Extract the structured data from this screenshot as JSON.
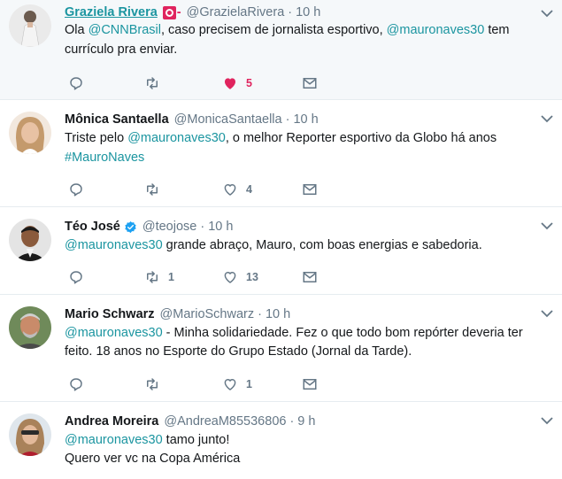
{
  "tweets": [
    {
      "name": "Graziela Rivera",
      "badge_dash": "-",
      "handle": "@GrazielaRivera",
      "dot": "·",
      "time": "10 h",
      "text_parts": [
        {
          "t": "Ola ",
          "link": false
        },
        {
          "t": "@CNNBrasil",
          "link": true
        },
        {
          "t": ", caso precisem de jornalista esportivo, ",
          "link": false
        },
        {
          "t": "@mauronaves30",
          "link": true
        },
        {
          "t": " tem",
          "link": false
        }
      ],
      "text_line2": [
        {
          "t": "currículo pra enviar.",
          "link": false
        }
      ],
      "replies": "",
      "retweets": "",
      "likes": "5",
      "liked": true
    },
    {
      "name": "Mônica Santaella",
      "handle": "@MonicaSantaella",
      "dot": "·",
      "time": "10 h",
      "text_parts": [
        {
          "t": "Triste pelo ",
          "link": false
        },
        {
          "t": "@mauronaves30",
          "link": true
        },
        {
          "t": ", o melhor Reporter esportivo da Globo há anos",
          "link": false
        }
      ],
      "text_line2": [
        {
          "t": "#MauroNaves",
          "link": true
        }
      ],
      "replies": "",
      "retweets": "",
      "likes": "4",
      "liked": false
    },
    {
      "name": "Téo José",
      "handle": "@teojose",
      "dot": "·",
      "time": "10 h",
      "text_parts": [
        {
          "t": "@mauronaves30",
          "link": true
        },
        {
          "t": " grande abraço, Mauro, com boas energias e sabedoria.",
          "link": false
        }
      ],
      "text_line2": [],
      "replies": "",
      "retweets": "1",
      "likes": "13",
      "liked": false
    },
    {
      "name": "Mario Schwarz",
      "handle": "@MarioSchwarz",
      "dot": "·",
      "time": "10 h",
      "text_parts": [
        {
          "t": "@mauronaves30",
          "link": true
        },
        {
          "t": " - Minha solidariedade. Fez o que todo bom repórter deveria ter",
          "link": false
        }
      ],
      "text_line2": [
        {
          "t": "feito. 18 anos no Esporte do Grupo Estado (Jornal da Tarde).",
          "link": false
        }
      ],
      "replies": "",
      "retweets": "",
      "likes": "1",
      "liked": false
    },
    {
      "name": "Andrea Moreira",
      "handle": "@AndreaM85536806",
      "dot": "·",
      "time": "9 h",
      "text_parts": [
        {
          "t": "@mauronaves30",
          "link": true
        },
        {
          "t": " tamo junto!",
          "link": false
        }
      ],
      "text_line2": [
        {
          "t": "Quero ver vc na Copa América",
          "link": false
        }
      ],
      "replies": "",
      "retweets": "",
      "likes": "",
      "liked": false
    }
  ],
  "colors": {
    "link": "#1b95a0",
    "like_active": "#e0245e",
    "muted": "#657786",
    "highlight_bg": "#f5f8fa"
  },
  "icons": {
    "reply": "reply-icon",
    "retweet": "retweet-icon",
    "like": "heart-icon",
    "dm": "envelope-icon",
    "caret": "chevron-down-icon",
    "verified": "verified-badge-icon"
  }
}
